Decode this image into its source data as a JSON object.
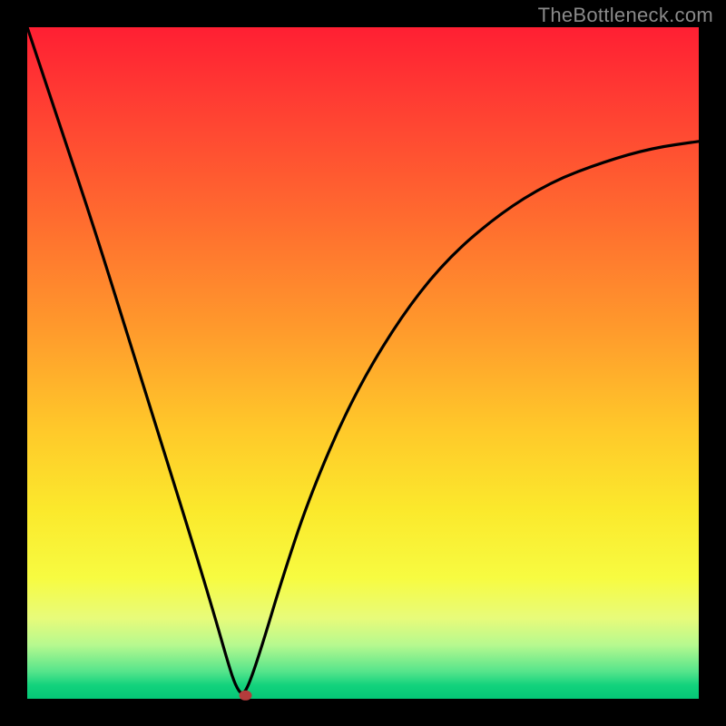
{
  "attribution": "TheBottleneck.com",
  "chart_data": {
    "type": "line",
    "title": "",
    "xlabel": "",
    "ylabel": "",
    "x_range": [
      0,
      100
    ],
    "y_range": [
      0,
      100
    ],
    "note": "Values are read off the gradient: y≈0 is optimal (green), y≈100 is worst (red). The curve drops steeply from the left edge to a minimum near x≈32 then rises with decreasing slope toward the right edge.",
    "series": [
      {
        "name": "bottleneck-curve",
        "x": [
          0,
          5,
          10,
          15,
          20,
          25,
          28,
          30,
          31,
          32,
          33,
          35,
          38,
          42,
          48,
          55,
          62,
          70,
          78,
          86,
          93,
          100
        ],
        "y": [
          100,
          85,
          70,
          54,
          38,
          22,
          12,
          5,
          2,
          0.5,
          2,
          8,
          18,
          30,
          44,
          56,
          65,
          72,
          77,
          80,
          82,
          83
        ]
      }
    ],
    "marker": {
      "x": 32.5,
      "y": 0.5
    },
    "colors": {
      "curve": "#000000",
      "marker": "#b43c3c",
      "gradient_top": "#ff1f33",
      "gradient_bottom": "#05c777",
      "frame": "#000000"
    }
  }
}
